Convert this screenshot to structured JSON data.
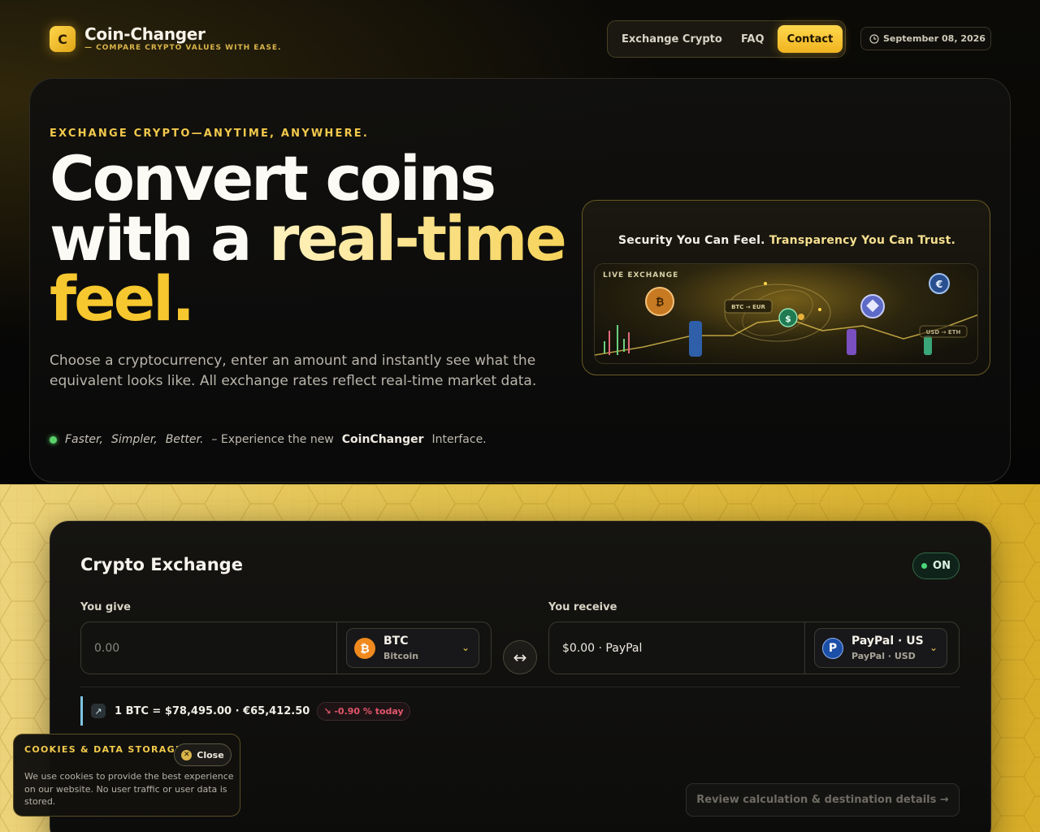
{
  "header": {
    "logo_glyph": "C",
    "brand_title": "Coin-Changer",
    "brand_subtitle": "— COMPARE CRYPTO VALUES WITH EASE.",
    "nav": [
      "Exchange Crypto",
      "FAQ"
    ],
    "contact_label": "Contact",
    "date": "September 08, 2026"
  },
  "hero": {
    "eyebrow": "EXCHANGE CRYPTO—ANYTIME, ANYWHERE.",
    "title_line1": "Convert coins",
    "title_line2a": "with a ",
    "title_line2b": "real-time",
    "title_line3": "feel.",
    "description": "Choose a cryptocurrency, enter an amount and instantly see what the equivalent looks like. All exchange rates reflect real-time market data.",
    "tag_words": [
      "Faster,",
      "Simpler,",
      "Better."
    ],
    "tag_mid": "– Experience the new",
    "tag_brand": "CoinChanger",
    "tag_end": "Interface."
  },
  "security": {
    "text_a": "Security You Can Feel. ",
    "text_b": "Transparency You Can Trust.",
    "live_label": "LIVE EXCHANGE",
    "tag1": "BTC → EUR",
    "tag2": "USD → ETH"
  },
  "exchange": {
    "title": "Crypto Exchange",
    "status": "ON",
    "give_label": "You give",
    "give_placeholder": "0.00",
    "give_code": "BTC",
    "give_name": "Bitcoin",
    "receive_label": "You receive",
    "receive_value": "$0.00 · PayPal",
    "receive_code": "PayPal · US",
    "receive_name": "PayPal · USD",
    "rate": "1 BTC = $78,495.00 · €65,412.50",
    "change": "↘ -0.90 % today",
    "review_label": "Review calculation & destination details →"
  },
  "cookie": {
    "title": "COOKIES & DATA STORAGE",
    "close_label": "Close",
    "text": "We use cookies to provide the best experience on our website. No user traffic or user data is stored."
  },
  "colors": {
    "accent": "#f2c94c",
    "positive": "#4cd47a",
    "negative": "#e2566a"
  }
}
